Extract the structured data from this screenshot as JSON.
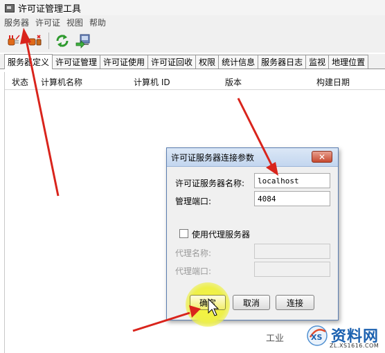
{
  "window": {
    "title": "许可证管理工具"
  },
  "menu": [
    "服务器",
    "许可证",
    "视图",
    "帮助"
  ],
  "toolbar": {
    "icons": [
      "connect-plug-icon",
      "disconnect-plug-icon",
      "refresh-icon",
      "export-icon"
    ]
  },
  "tabs": [
    "服务器定义",
    "许可证管理",
    "许可证使用",
    "许可证回收",
    "权限",
    "统计信息",
    "服务器日志",
    "监视",
    "地理位置"
  ],
  "active_tab": "服务器定义",
  "table": {
    "columns": [
      "状态",
      "计算机名称",
      "计算机 ID",
      "版本",
      "构建日期"
    ]
  },
  "dialog": {
    "title": "许可证服务器连接参数",
    "close_glyph": "✕",
    "server_name_label": "许可证服务器名称:",
    "server_name_value": "localhost",
    "port_label": "管理端口:",
    "port_value": "4084",
    "use_proxy_label": "使用代理服务器",
    "use_proxy_checked": false,
    "proxy_name_label": "代理名称:",
    "proxy_name_value": "",
    "proxy_port_label": "代理端口:",
    "proxy_port_value": "",
    "ok_label": "确定",
    "cancel_label": "取消",
    "connect_label": "连接"
  },
  "annotations": {
    "arrow_color": "#d9241c",
    "highlight_color": "#f4f23a"
  },
  "watermark": {
    "text": "工业",
    "site_name": "资料网",
    "url": "ZL.XS1616.COM"
  }
}
